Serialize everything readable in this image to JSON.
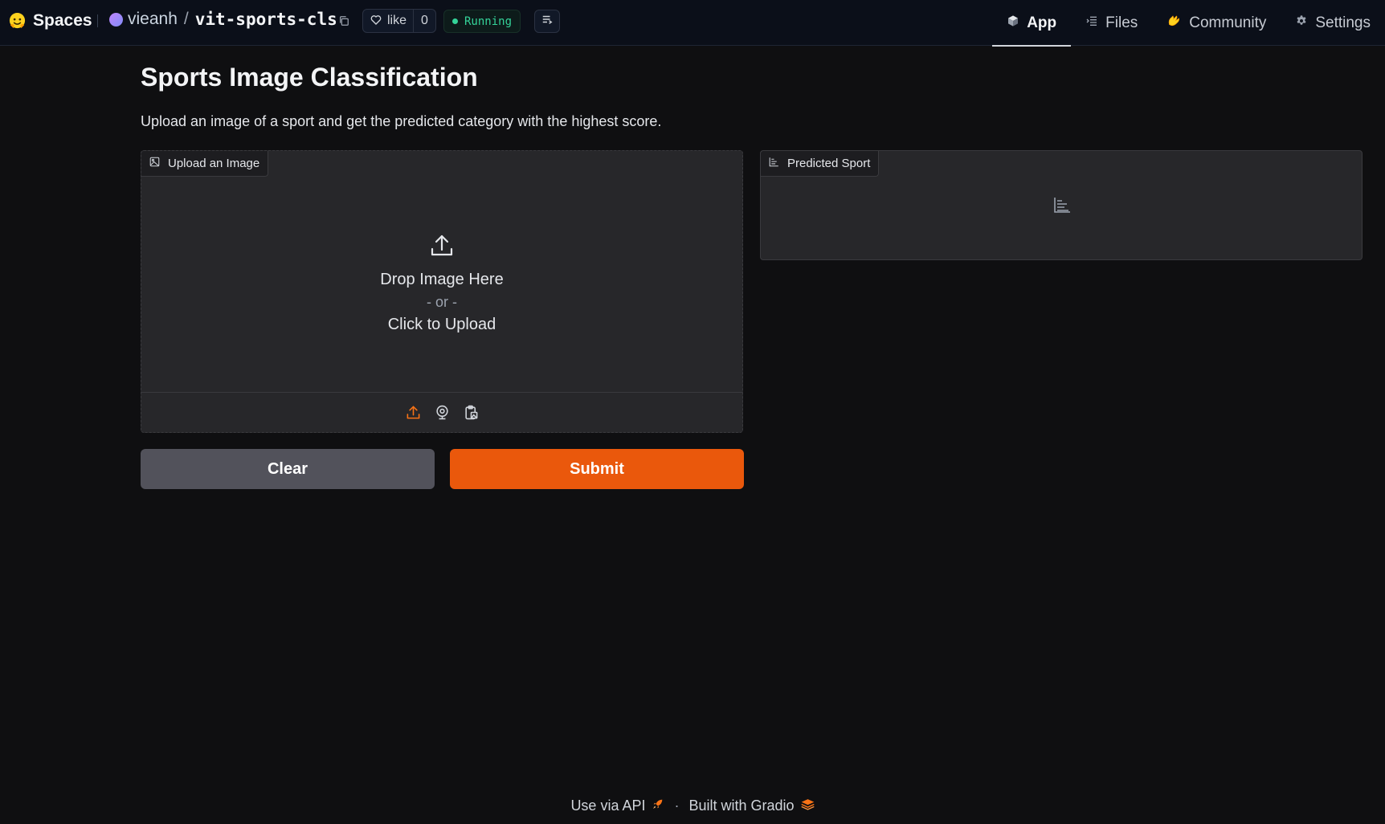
{
  "header": {
    "brand_label": "Spaces",
    "repo_owner": "vieanh",
    "repo_name": "vit-sports-cls",
    "like_label": "like",
    "like_count": "0",
    "status": "Running",
    "status_color": "#34d399"
  },
  "nav": {
    "items": [
      {
        "label": "App",
        "icon": "cube-icon",
        "active": true
      },
      {
        "label": "Files",
        "icon": "files-icon",
        "active": false
      },
      {
        "label": "Community",
        "icon": "community-icon",
        "active": false
      },
      {
        "label": "Settings",
        "icon": "gear-icon",
        "active": false
      }
    ]
  },
  "main": {
    "title": "Sports Image Classification",
    "description": "Upload an image of a sport and get the predicted category with the highest score."
  },
  "upload_panel": {
    "label": "Upload an Image",
    "drop_text": "Drop Image Here",
    "or_text": "- or -",
    "click_text": "Click to Upload",
    "sources": [
      "upload-icon",
      "webcam-icon",
      "clipboard-icon"
    ]
  },
  "result_panel": {
    "label": "Predicted Sport"
  },
  "buttons": {
    "clear_label": "Clear",
    "submit_label": "Submit",
    "submit_color": "#ea580c"
  },
  "footer": {
    "api_label": "Use via API",
    "separator": "·",
    "built_label": "Built with Gradio"
  }
}
